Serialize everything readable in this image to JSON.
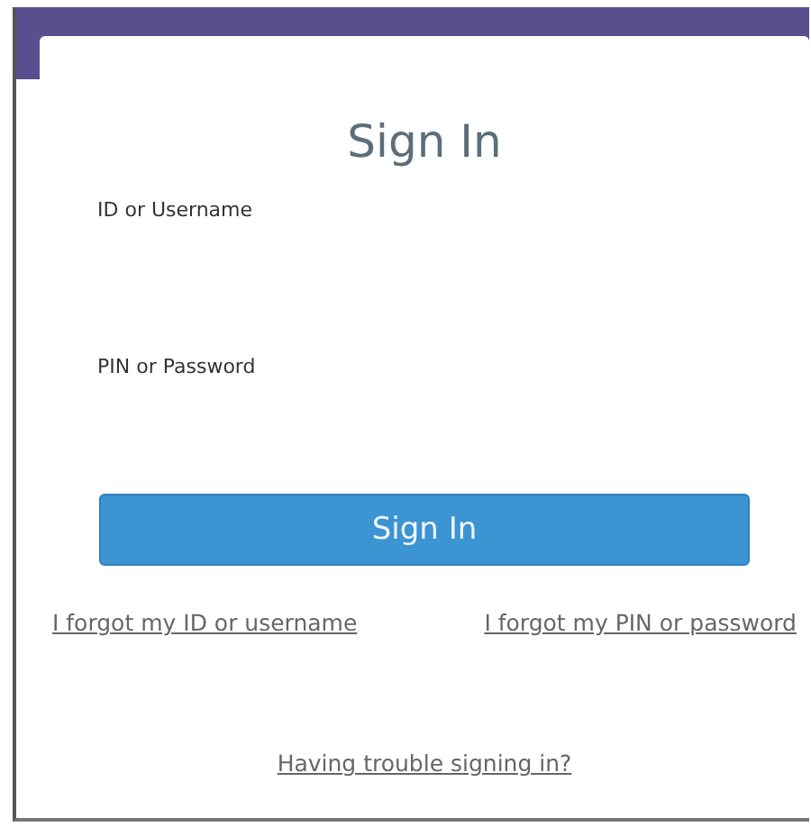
{
  "title": "Sign In",
  "fields": [
    {
      "label": "ID or Username"
    },
    {
      "label": "PIN or Password"
    }
  ],
  "submit": "Sign In",
  "links": [
    "I forgot my ID or username",
    "I forgot my PIN or password"
  ],
  "help_link": "Having trouble signing in?"
}
